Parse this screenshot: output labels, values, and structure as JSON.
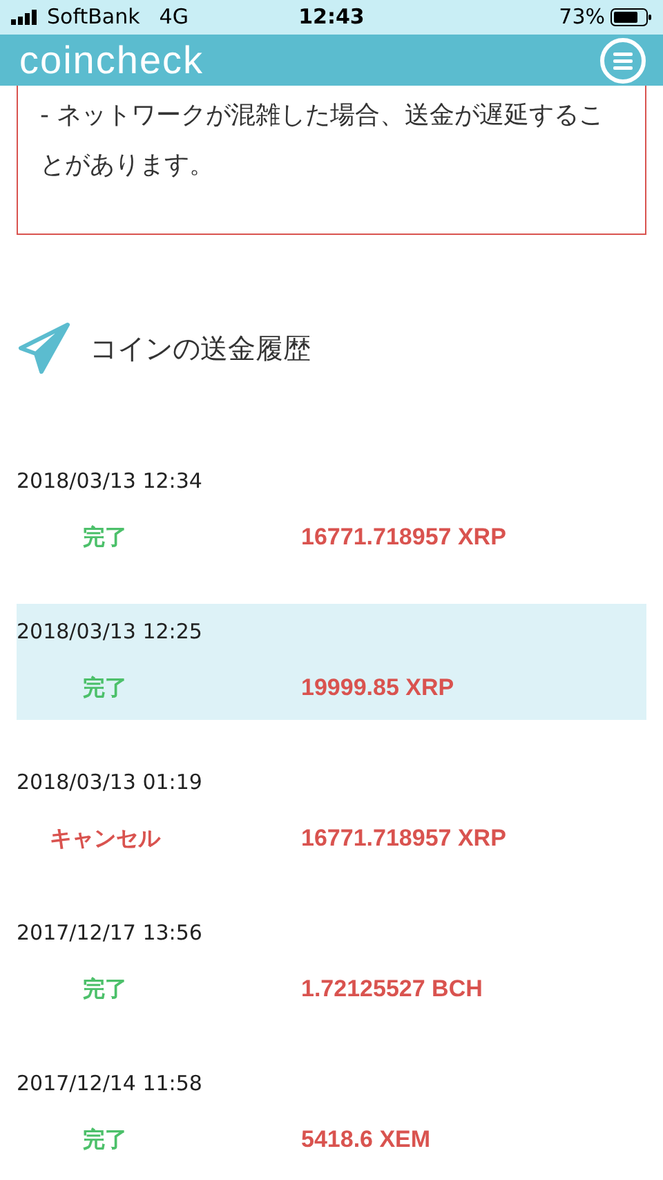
{
  "status_bar": {
    "carrier": "SoftBank",
    "network": "4G",
    "time": "12:43",
    "battery": "73%"
  },
  "header": {
    "logo": "coincheck"
  },
  "notice": {
    "text": "- ネットワークが混雑した場合、送金が遅延することがあります。"
  },
  "section": {
    "title": "コインの送金履歴"
  },
  "history": [
    {
      "date": "2018/03/13 12:34",
      "status": "完了",
      "kind": "done",
      "amount": "16771.718957 XRP",
      "selected": false
    },
    {
      "date": "2018/03/13 12:25",
      "status": "完了",
      "kind": "done",
      "amount": "19999.85 XRP",
      "selected": true
    },
    {
      "date": "2018/03/13 01:19",
      "status": "キャンセル",
      "kind": "cancel",
      "amount": "16771.718957 XRP",
      "selected": false
    },
    {
      "date": "2017/12/17 13:56",
      "status": "完了",
      "kind": "done",
      "amount": "1.72125527 BCH",
      "selected": false
    },
    {
      "date": "2017/12/14 11:58",
      "status": "完了",
      "kind": "done",
      "amount": "5418.6 XEM",
      "selected": false
    }
  ]
}
